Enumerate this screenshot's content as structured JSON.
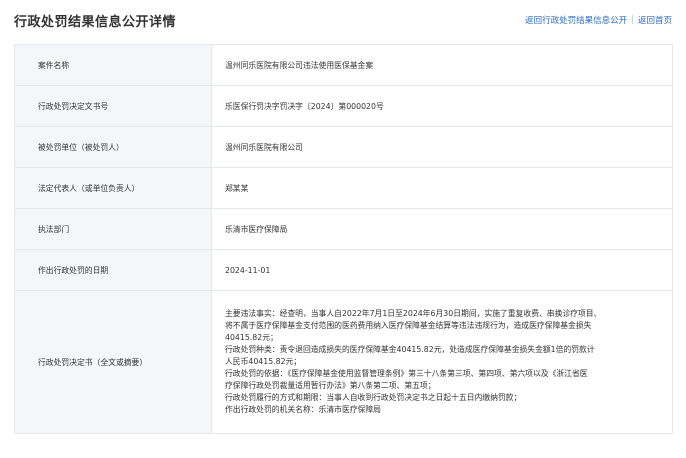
{
  "header": {
    "title": "行政处罚结果信息公开详情",
    "link_back_list": "返回行政处罚结果信息公开",
    "separator": "|",
    "link_back_home": "返回首页"
  },
  "rows": [
    {
      "label": "案件名称",
      "value": "温州同乐医院有限公司违法使用医保基金案"
    },
    {
      "label": "行政处罚决定文书号",
      "value": "乐医保行罚决字罚决字〔2024〕第000020号"
    },
    {
      "label": "被处罚单位（被处罚人）",
      "value": "温州同乐医院有限公司"
    },
    {
      "label": "法定代表人（或单位负责人）",
      "value": "郑某某"
    },
    {
      "label": "执法部门",
      "value": "乐清市医疗保障局"
    },
    {
      "label": "作出行政处罚的日期",
      "value": "2024-11-01"
    }
  ],
  "decision": {
    "label": "行政处罚决定书（全文或摘要）",
    "lines": [
      "主要违法事实：经查明，当事人自2022年7月1日至2024年6月30日期间，实施了重复收费、串换诊疗项目、",
      "将不属于医疗保障基金支付范围的医药费用纳入医疗保障基金结算等违法违规行为，造成医疗保障基金损失",
      "40415.82元；",
      "行政处罚种类：责令退回造成损失的医疗保障基金40415.82元，处造成医疗保障基金损失金额1倍的罚款计",
      "人民币40415.82元；",
      "行政处罚的依据：《医疗保障基金使用监督管理条例》第三十八条第三项、第四项、第六项以及《浙江省医",
      "疗保障行政处罚裁量适用暂行办法》第八条第二项、第五项；",
      "行政处罚履行的方式和期限：当事人自收到行政处罚决定书之日起十五日内缴纳罚款；",
      "作出行政处罚的机关名称：乐清市医疗保障局"
    ]
  }
}
